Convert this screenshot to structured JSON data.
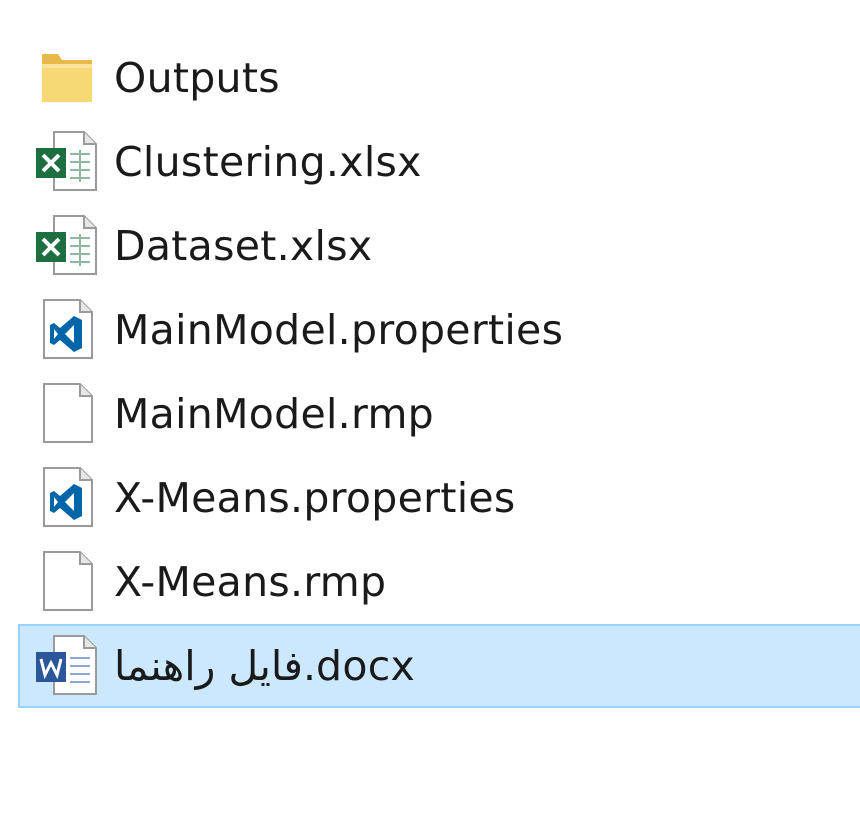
{
  "files": [
    {
      "name": "Outputs",
      "icon": "folder-icon",
      "type": "folder",
      "selected": false
    },
    {
      "name": "Clustering.xlsx",
      "icon": "excel-icon",
      "type": "xlsx",
      "selected": false
    },
    {
      "name": "Dataset.xlsx",
      "icon": "excel-icon",
      "type": "xlsx",
      "selected": false
    },
    {
      "name": "MainModel.properties",
      "icon": "vscode-file-icon",
      "type": "properties",
      "selected": false
    },
    {
      "name": "MainModel.rmp",
      "icon": "blank-file-icon",
      "type": "rmp",
      "selected": false
    },
    {
      "name": "X-Means.properties",
      "icon": "vscode-file-icon",
      "type": "properties",
      "selected": false
    },
    {
      "name": "X-Means.rmp",
      "icon": "blank-file-icon",
      "type": "rmp",
      "selected": false
    },
    {
      "name": "فایل راهنما.docx",
      "icon": "word-icon",
      "type": "docx",
      "selected": true
    }
  ],
  "colors": {
    "selection_bg": "#cce8ff",
    "selection_border": "#99d1ff",
    "folder": "#f8d775",
    "excel": "#1d6f42",
    "word": "#2b579a",
    "vscode": "#0065a9"
  }
}
